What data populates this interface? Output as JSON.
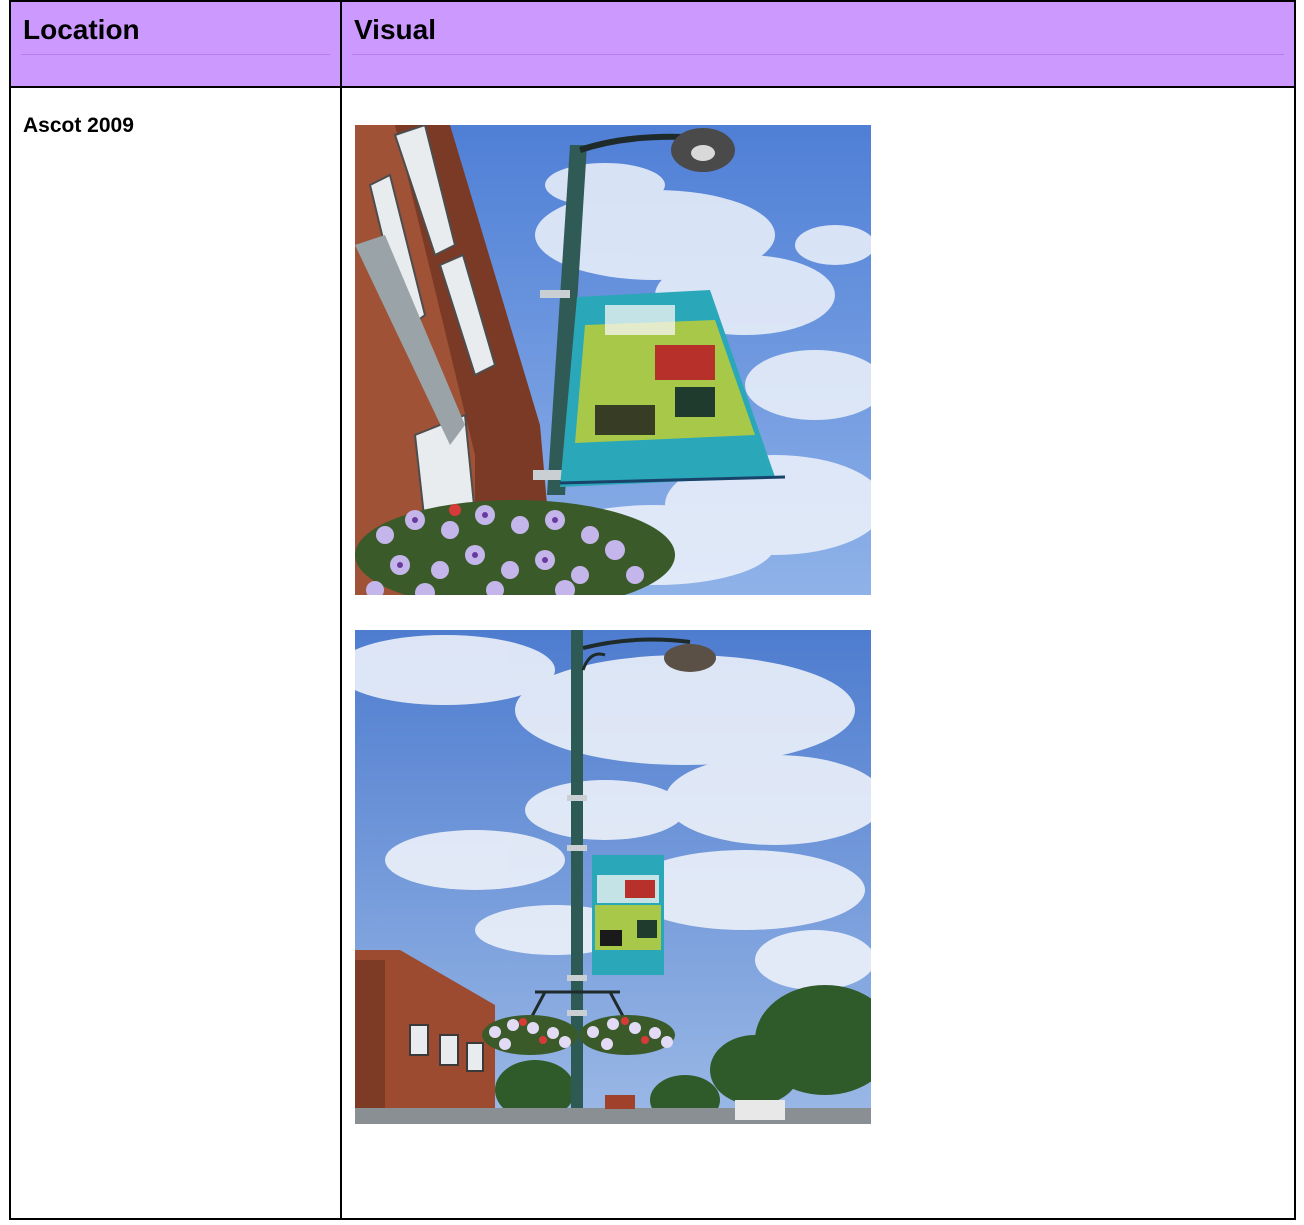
{
  "table": {
    "headers": {
      "location": "Location",
      "visual": "Visual"
    },
    "rows": [
      {
        "location": "Ascot 2009",
        "photos": [
          {
            "subject": "lamppost-banner-closeup"
          },
          {
            "subject": "lamppost-banner-street"
          }
        ]
      }
    ]
  },
  "colors": {
    "header_bg": "#cc99ff",
    "border": "#000000",
    "sky": "#5b86d4",
    "pole": "#2f5a55",
    "banner": "#2aa7b8",
    "brick": "#8a4a36"
  }
}
